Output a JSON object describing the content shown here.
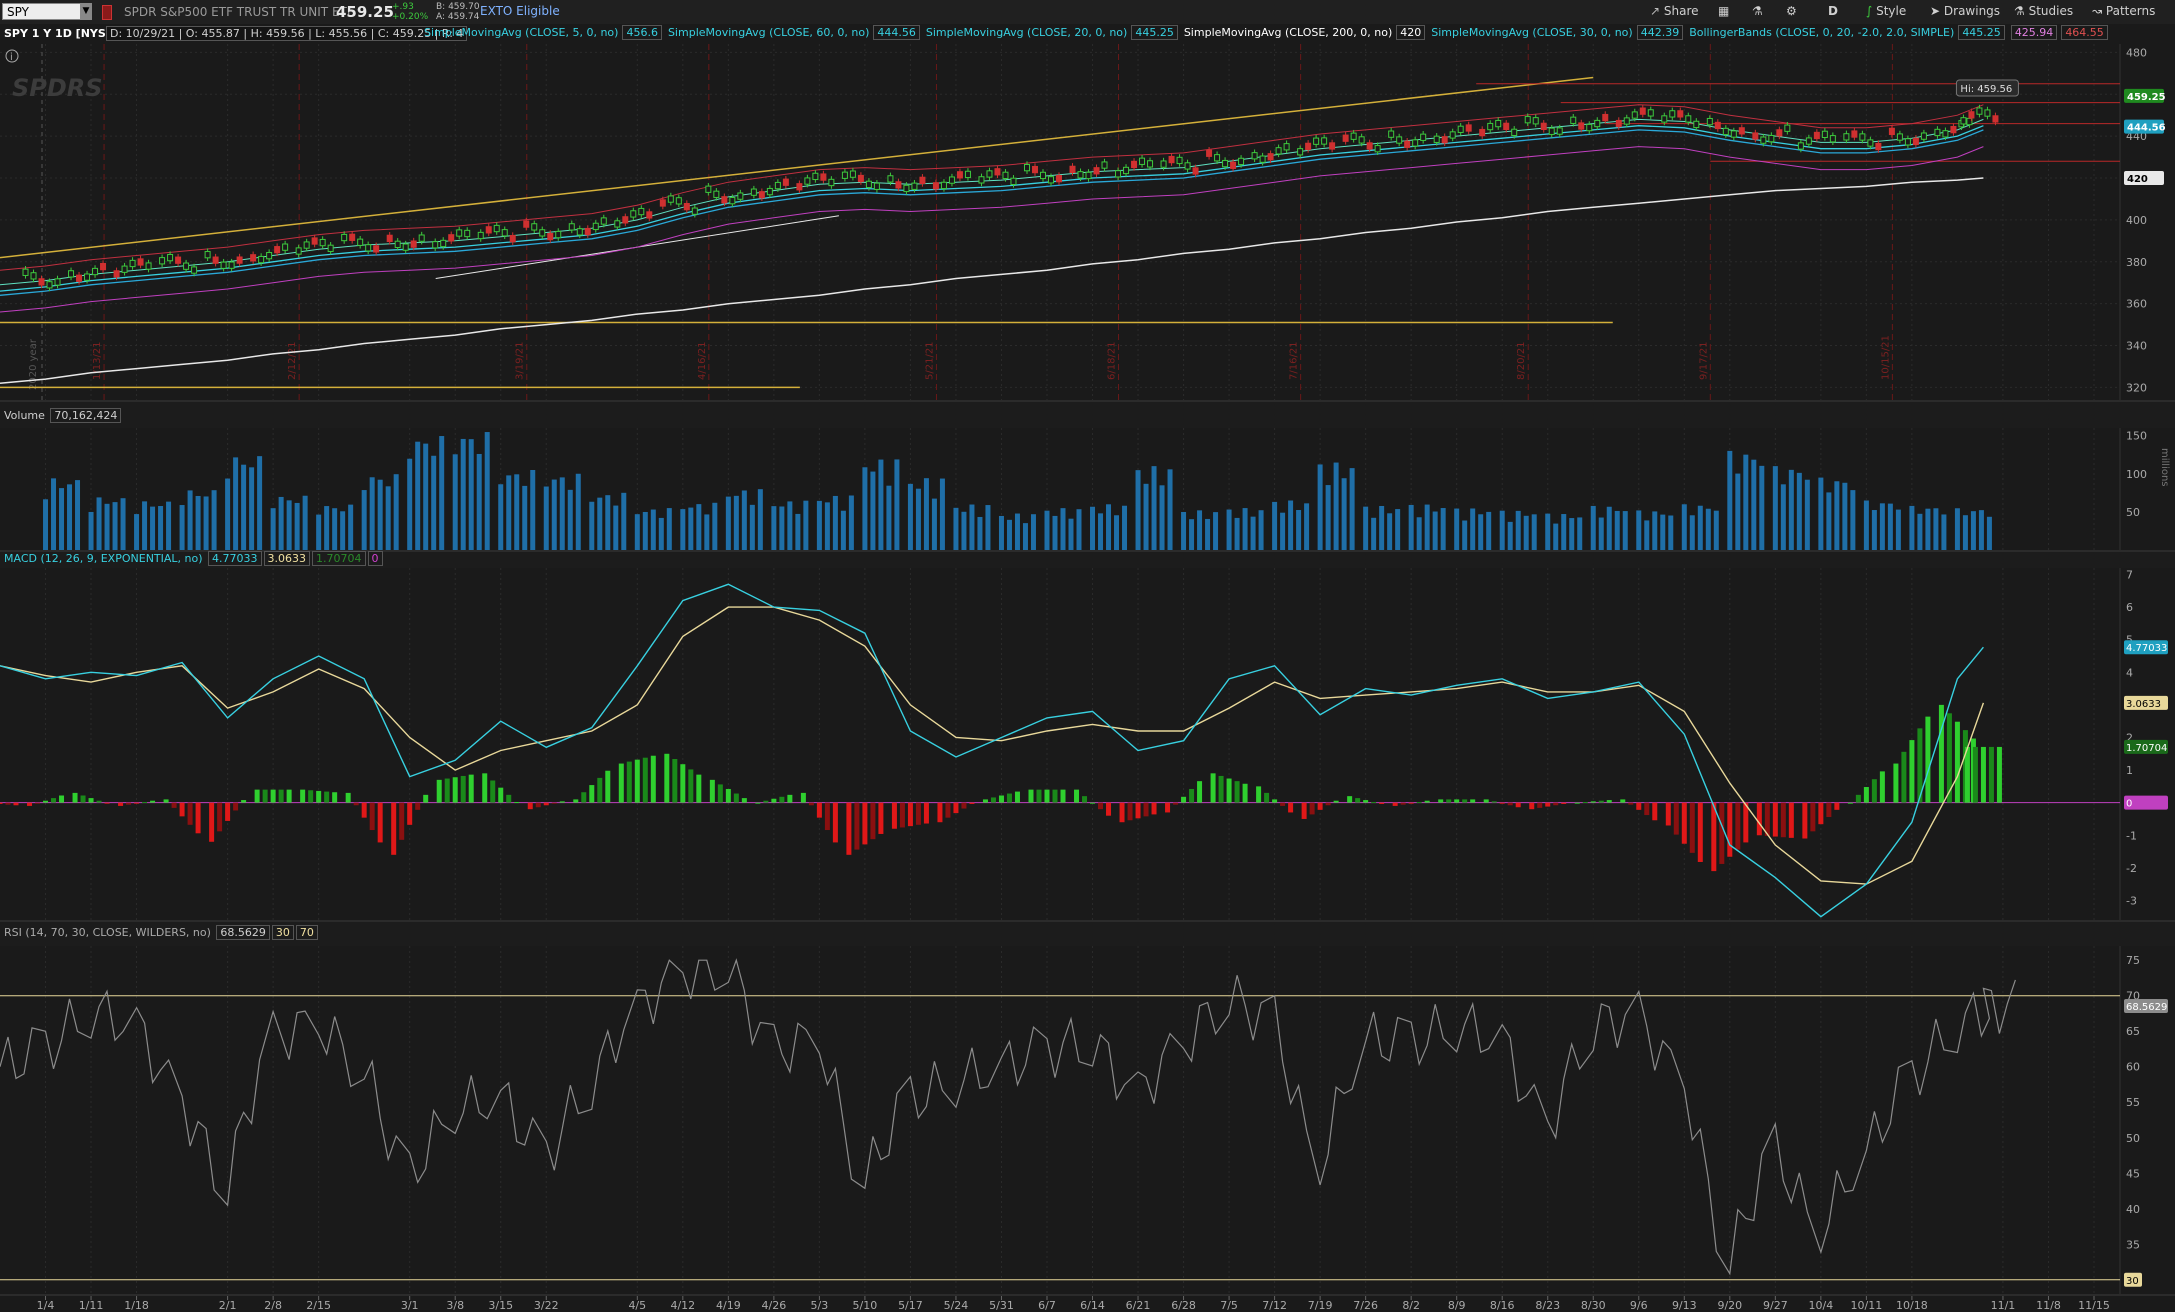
{
  "toolbar": {
    "symbol": "SPY",
    "description": "SPDR S&P500 ETF TRUST TR UNIT ETF",
    "last": "459.25",
    "change": "+.93",
    "change_pct": "+0.20%",
    "bid": "B: 459.70",
    "ask": "A: 459.74",
    "exto": "EXTO Eligible",
    "share": "Share",
    "period": "D",
    "style": "Style",
    "drawings": "Drawings",
    "studies": "Studies",
    "patterns": "Patterns"
  },
  "infobar": {
    "title": "SPY 1 Y 1D [NYSE]",
    "ohlc": "D: 10/29/21 | O: 455.87 | H: 459.56 | L: 455.56 | C: 459.25 | R: 4",
    "studies": [
      {
        "label": "SimpleMovingAvg (CLOSE, 5, 0, no)",
        "value": "456.6",
        "color": "#38d0e0"
      },
      {
        "label": "SimpleMovingAvg (CLOSE, 60, 0, no)",
        "value": "444.56",
        "color": "#38d0e0"
      },
      {
        "label": "SimpleMovingAvg (CLOSE, 20, 0, no)",
        "value": "445.25",
        "color": "#38d0e0"
      },
      {
        "label": "SimpleMovingAvg (CLOSE, 200, 0, no)",
        "value": "420",
        "color": "#ffffff"
      },
      {
        "label": "SimpleMovingAvg (CLOSE, 30, 0, no)",
        "value": "442.39",
        "color": "#38d0e0"
      },
      {
        "label": "BollingerBands (CLOSE, 0, 20, -2.0, 2.0, SIMPLE)",
        "value": "445.25",
        "color": "#38d0e0"
      }
    ],
    "bb_lower": "425.94",
    "bb_upper": "464.55"
  },
  "price_pane": {
    "hi_label": "Hi: 459.56",
    "yticks": [
      480,
      460,
      440,
      420,
      400,
      380,
      360,
      340,
      320
    ],
    "ylim": [
      314,
      484
    ],
    "last_tag": "459.25",
    "sma60_tag": "444.56",
    "sma200_tag": "420",
    "watermark": "SPDRS",
    "year_marker": "2020 year",
    "event_labels": [
      "1/13/21",
      "2/12/21",
      "3/19/21",
      "4/16/21",
      "5/21/21",
      "6/18/21",
      "7/16/21",
      "8/20/21",
      "9/17/21",
      "10/15/21"
    ]
  },
  "volume_pane": {
    "label": "Volume",
    "value": "70,162,424",
    "yticks": [
      150,
      100,
      50
    ],
    "unit": "millions",
    "color": "#1f6fa8"
  },
  "macd_pane": {
    "label": "MACD (12, 26, 9, EXPONENTIAL, no)",
    "value": "4.77033",
    "avg": "3.0633",
    "diff": "1.70704",
    "zero": "0",
    "yticks": [
      7,
      6,
      5,
      4,
      3,
      2,
      1,
      0,
      -1,
      -2,
      -3
    ],
    "tags": {
      "value": "4.77033",
      "avg": "3.0633",
      "diff": "1.70704",
      "zero": "0"
    }
  },
  "rsi_pane": {
    "label": "RSI (14, 70, 30, CLOSE, WILDERS, no)",
    "value": "68.5629",
    "oversold": "30",
    "overbought": "70",
    "yticks": [
      75,
      70,
      65,
      60,
      55,
      50,
      45,
      40,
      35,
      30
    ],
    "tag": "68.5629"
  },
  "x_axis": {
    "labels": [
      "1/4",
      "1/11",
      "1/18",
      "2/1",
      "2/8",
      "2/15",
      "3/1",
      "3/8",
      "3/15",
      "3/22",
      "4/5",
      "4/12",
      "4/19",
      "4/26",
      "5/3",
      "5/10",
      "5/17",
      "5/24",
      "5/31",
      "6/7",
      "6/14",
      "6/21",
      "6/28",
      "7/5",
      "7/12",
      "7/19",
      "7/26",
      "8/2",
      "8/9",
      "8/16",
      "8/23",
      "8/30",
      "9/6",
      "9/13",
      "9/20",
      "9/27",
      "10/4",
      "10/11",
      "10/18",
      "11/1",
      "11/8",
      "11/15"
    ]
  },
  "chart_data": [
    {
      "type": "line",
      "title": "SPY 1 Y 1D [NYSE]",
      "x": [
        "2020-12-28",
        "2021-01-04",
        "2021-01-11",
        "2021-01-18",
        "2021-01-25",
        "2021-02-01",
        "2021-02-08",
        "2021-02-15",
        "2021-02-22",
        "2021-03-01",
        "2021-03-08",
        "2021-03-15",
        "2021-03-22",
        "2021-03-29",
        "2021-04-05",
        "2021-04-12",
        "2021-04-19",
        "2021-04-26",
        "2021-05-03",
        "2021-05-10",
        "2021-05-17",
        "2021-05-24",
        "2021-05-31",
        "2021-06-07",
        "2021-06-14",
        "2021-06-21",
        "2021-06-28",
        "2021-07-05",
        "2021-07-12",
        "2021-07-19",
        "2021-07-26",
        "2021-08-02",
        "2021-08-09",
        "2021-08-16",
        "2021-08-23",
        "2021-08-30",
        "2021-09-06",
        "2021-09-13",
        "2021-09-20",
        "2021-09-27",
        "2021-10-04",
        "2021-10-11",
        "2021-10-18",
        "2021-10-25",
        "2021-10-29"
      ],
      "series": [
        {
          "name": "SimpleMovingAvg (CLOSE, 200, 0, no)",
          "values": [
            322,
            324,
            327,
            329,
            331,
            333,
            336,
            338,
            341,
            343,
            345,
            348,
            350,
            352,
            355,
            357,
            360,
            362,
            364,
            367,
            369,
            372,
            374,
            376,
            379,
            381,
            384,
            386,
            389,
            391,
            394,
            396,
            399,
            401,
            404,
            406,
            408,
            410,
            412,
            414,
            415,
            416,
            418,
            419,
            420
          ]
        },
        {
          "name": "SimpleMovingAvg (CLOSE, 20, 0, no)",
          "values": [
            366,
            368,
            371,
            373,
            375,
            377,
            380,
            383,
            385,
            386,
            387,
            389,
            391,
            393,
            397,
            403,
            408,
            411,
            414,
            415,
            414,
            415,
            416,
            418,
            420,
            421,
            422,
            425,
            428,
            431,
            433,
            435,
            437,
            439,
            441,
            443,
            445,
            444,
            440,
            437,
            434,
            434,
            436,
            440,
            445
          ]
        }
      ],
      "xlabel": "",
      "ylabel": "",
      "ylim": [
        314,
        484
      ]
    },
    {
      "type": "bar",
      "title": "Volume",
      "x": [
        "2021-01-04",
        "2021-01-11",
        "2021-01-18",
        "2021-01-25",
        "2021-02-01",
        "2021-02-08",
        "2021-02-15",
        "2021-02-22",
        "2021-03-01",
        "2021-03-08",
        "2021-03-15",
        "2021-03-22",
        "2021-03-29",
        "2021-04-05",
        "2021-04-12",
        "2021-04-19",
        "2021-04-26",
        "2021-05-03",
        "2021-05-10",
        "2021-05-17",
        "2021-05-24",
        "2021-05-31",
        "2021-06-07",
        "2021-06-14",
        "2021-06-21",
        "2021-06-28",
        "2021-07-05",
        "2021-07-12",
        "2021-07-19",
        "2021-07-26",
        "2021-08-02",
        "2021-08-09",
        "2021-08-16",
        "2021-08-23",
        "2021-08-30",
        "2021-09-06",
        "2021-09-13",
        "2021-09-20",
        "2021-09-27",
        "2021-10-04",
        "2021-10-11",
        "2021-10-18",
        "2021-10-25"
      ],
      "values": [
        95,
        70,
        65,
        80,
        125,
        72,
        60,
        100,
        150,
        155,
        105,
        100,
        75,
        55,
        62,
        80,
        65,
        72,
        120,
        95,
        60,
        48,
        55,
        60,
        110,
        52,
        55,
        65,
        115,
        58,
        60,
        55,
        52,
        48,
        58,
        52,
        60,
        130,
        110,
        95,
        65,
        58,
        55
      ],
      "yunit": "millions",
      "ylim": [
        0,
        160
      ]
    },
    {
      "type": "line",
      "title": "MACD (12, 26, 9, EXPONENTIAL, no)",
      "x": [
        "2020-12-28",
        "2021-01-04",
        "2021-01-11",
        "2021-01-18",
        "2021-01-25",
        "2021-02-01",
        "2021-02-08",
        "2021-02-15",
        "2021-02-22",
        "2021-03-01",
        "2021-03-08",
        "2021-03-15",
        "2021-03-22",
        "2021-03-29",
        "2021-04-05",
        "2021-04-12",
        "2021-04-19",
        "2021-04-26",
        "2021-05-03",
        "2021-05-10",
        "2021-05-17",
        "2021-05-24",
        "2021-05-31",
        "2021-06-07",
        "2021-06-14",
        "2021-06-21",
        "2021-06-28",
        "2021-07-05",
        "2021-07-12",
        "2021-07-19",
        "2021-07-26",
        "2021-08-02",
        "2021-08-09",
        "2021-08-16",
        "2021-08-23",
        "2021-08-30",
        "2021-09-06",
        "2021-09-13",
        "2021-09-20",
        "2021-09-27",
        "2021-10-04",
        "2021-10-11",
        "2021-10-18",
        "2021-10-25",
        "2021-10-29"
      ],
      "series": [
        {
          "name": "Value",
          "values": [
            4.2,
            3.8,
            4.0,
            3.9,
            4.3,
            2.6,
            3.8,
            4.5,
            3.8,
            0.8,
            1.3,
            2.5,
            1.7,
            2.3,
            4.2,
            6.2,
            6.7,
            6.0,
            5.9,
            5.2,
            2.2,
            1.4,
            2.0,
            2.6,
            2.8,
            1.6,
            1.9,
            3.8,
            4.2,
            2.7,
            3.5,
            3.3,
            3.6,
            3.8,
            3.2,
            3.4,
            3.7,
            2.1,
            -1.3,
            -2.3,
            -3.5,
            -2.5,
            -0.6,
            3.8,
            4.77
          ]
        },
        {
          "name": "Avg",
          "values": [
            4.2,
            3.9,
            3.7,
            4.0,
            4.2,
            2.9,
            3.4,
            4.1,
            3.5,
            2.0,
            1.0,
            1.6,
            1.9,
            2.2,
            3.0,
            5.1,
            6.0,
            6.0,
            5.6,
            4.8,
            3.0,
            2.0,
            1.9,
            2.2,
            2.4,
            2.2,
            2.2,
            2.9,
            3.7,
            3.2,
            3.3,
            3.4,
            3.5,
            3.7,
            3.4,
            3.4,
            3.6,
            2.8,
            0.6,
            -1.3,
            -2.4,
            -2.5,
            -1.8,
            0.8,
            3.06
          ]
        },
        {
          "name": "Diff",
          "values": [
            0,
            -0.1,
            0.3,
            -0.1,
            0.1,
            -1.2,
            0.4,
            0.4,
            0.3,
            -1.6,
            0.7,
            0.9,
            -0.2,
            0.1,
            1.2,
            1.5,
            0.7,
            0.0,
            0.3,
            -1.6,
            -0.8,
            -0.6,
            0.1,
            0.4,
            0.4,
            -0.6,
            -0.3,
            0.9,
            0.5,
            -0.5,
            0.2,
            -0.1,
            0.1,
            0.1,
            -0.2,
            0.0,
            0.1,
            -0.7,
            -2.1,
            -1.0,
            -1.1,
            0.0,
            1.2,
            3.0,
            1.71
          ]
        }
      ],
      "ylim": [
        -3.6,
        7.2
      ]
    },
    {
      "type": "line",
      "title": "RSI (14, 70, 30, CLOSE, WILDERS, no)",
      "x": [
        "2020-12-28",
        "2021-01-04",
        "2021-01-11",
        "2021-01-18",
        "2021-01-25",
        "2021-02-01",
        "2021-02-08",
        "2021-02-15",
        "2021-02-22",
        "2021-03-01",
        "2021-03-08",
        "2021-03-15",
        "2021-03-22",
        "2021-03-29",
        "2021-04-05",
        "2021-04-12",
        "2021-04-19",
        "2021-04-26",
        "2021-05-03",
        "2021-05-10",
        "2021-05-17",
        "2021-05-24",
        "2021-05-31",
        "2021-06-07",
        "2021-06-14",
        "2021-06-21",
        "2021-06-28",
        "2021-07-05",
        "2021-07-12",
        "2021-07-19",
        "2021-07-26",
        "2021-08-02",
        "2021-08-09",
        "2021-08-16",
        "2021-08-23",
        "2021-08-30",
        "2021-09-06",
        "2021-09-13",
        "2021-09-20",
        "2021-09-27",
        "2021-10-04",
        "2021-10-11",
        "2021-10-18",
        "2021-10-25",
        "2021-10-29"
      ],
      "series": [
        {
          "name": "RSI",
          "values": [
            60,
            62,
            68,
            66,
            55,
            44,
            64,
            66,
            60,
            44,
            54,
            56,
            47,
            58,
            68,
            73,
            75,
            62,
            64,
            44,
            55,
            58,
            60,
            62,
            64,
            56,
            63,
            70,
            66,
            46,
            64,
            63,
            66,
            64,
            51,
            66,
            67,
            58,
            33,
            48,
            37,
            48,
            58,
            66,
            68.56
          ]
        }
      ],
      "ylim": [
        28,
        77
      ]
    }
  ]
}
